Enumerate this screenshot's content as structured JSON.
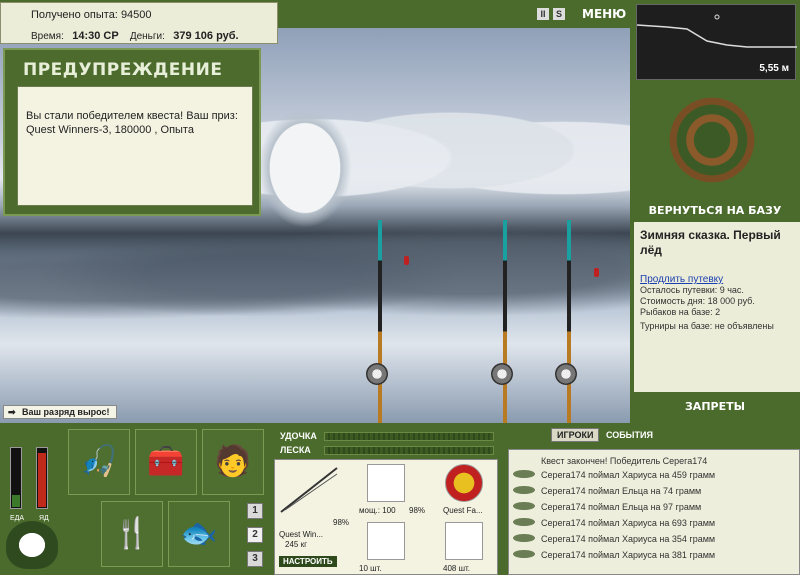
{
  "info": {
    "exp_label": "Получено опыта:",
    "exp_value": "94500",
    "time_label": "Время:",
    "time_value": "14:30 СР",
    "money_label": "Деньги:",
    "money_value": "379 106 руб."
  },
  "warning": {
    "title": "ПРЕДУПРЕЖДЕНИЕ",
    "message": "Вы стали победителем квеста! Ваш приз: Quest Winners-3, 180000 , Опыта"
  },
  "top_icons": [
    "pause-icon",
    "sound-icon"
  ],
  "menu_label": "МЕНЮ",
  "depth": {
    "value": "5,55 м"
  },
  "right": {
    "back_label": "ВЕРНУТЬСЯ НА БАЗУ",
    "location_name": "Зимняя сказка. Первый лёд",
    "extend_link": "Продлить путевку",
    "lines": [
      "Осталось путевки: 9 час.",
      "Стоимость дня: 18 000 руб.",
      "Рыбаков на базе: 2",
      "Турниры на базе: не объявлены"
    ],
    "bans_label": "ЗАПРЕТЫ"
  },
  "rank_notice": "Ваш разряд вырос!",
  "meters": {
    "food_label": "ЕДА",
    "poison_label": "ЯД",
    "food_level": 0.2,
    "poison_level": 0.9
  },
  "action_tiles": [
    "rods-icon",
    "tackle-box-icon",
    "fisherman-icon",
    "food-icon",
    "fish-icon"
  ],
  "page_numbers": [
    "1",
    "2",
    "3"
  ],
  "gauges": {
    "rod_label": "УДОЧКА",
    "line_label": "ЛЕСКА"
  },
  "tackle": {
    "rod_name": "Quest Win...",
    "rod_weight": "245 кг",
    "rod_percent": "98%",
    "reel_label": "мощ.: 100",
    "reel_percent": "98%",
    "bait_label": "Quest Fa...",
    "hook_label": "10 шт.",
    "lure_label": "408 шт.",
    "setup_label": "НАСТРОИТЬ"
  },
  "chat_tabs": {
    "players": "ИГРОКИ",
    "events": "СОБЫТИЯ"
  },
  "chat": [
    "Квест закончен! Победитель Серега174",
    "Серега174 поймал Хариуса на 459 грамм",
    "Серега174 поймал Ельца на 74 грамм",
    "Серега174 поймал Ельца на 97 грамм",
    "Серега174 поймал Хариуса на 693 грамм",
    "Серега174 поймал Хариуса на 354 грамм",
    "Серега174 поймал Хариуса на 381 грамм"
  ]
}
